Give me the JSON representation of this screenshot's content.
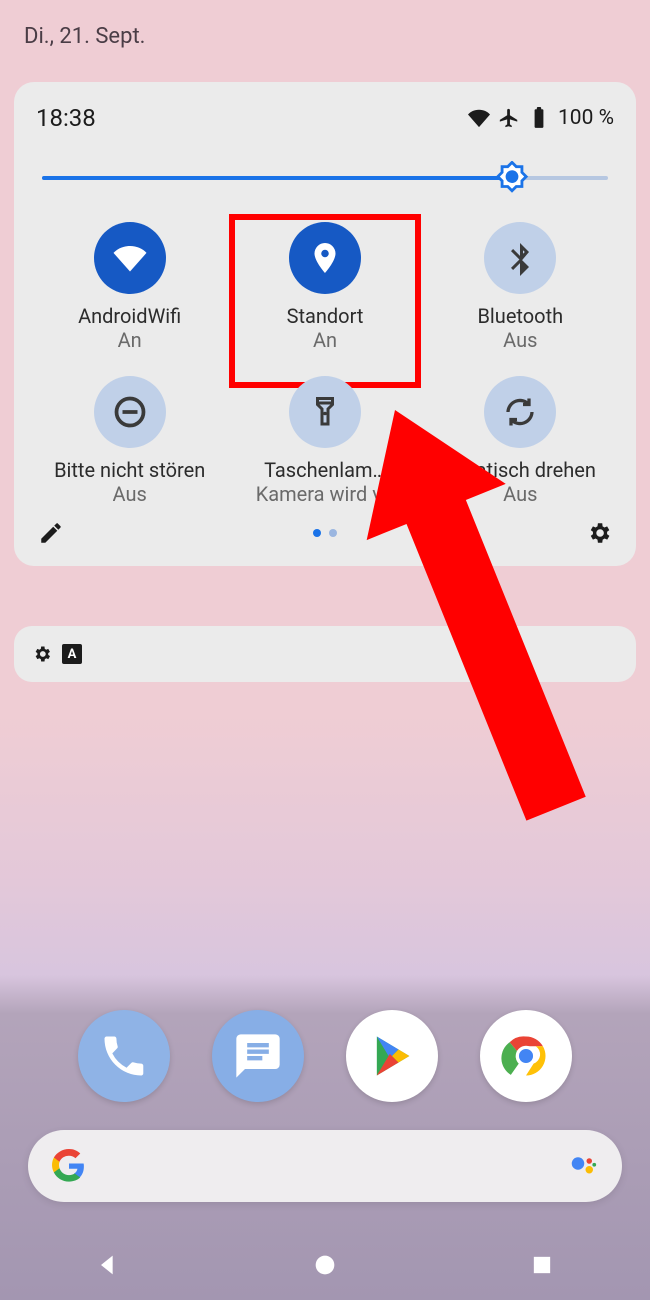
{
  "date": "Di., 21. Sept.",
  "status": {
    "time": "18:38",
    "battery": "100 %"
  },
  "brightness_percent": 83,
  "tiles": [
    {
      "label": "AndroidWifi",
      "state": "An"
    },
    {
      "label": "Standort",
      "state": "An"
    },
    {
      "label": "Bluetooth",
      "state": "Aus"
    },
    {
      "label": "Bitte nicht stören",
      "state": "Aus"
    },
    {
      "label": "Taschenlam…",
      "state": "Kamera wird v…"
    },
    {
      "label": "…matisch drehen",
      "state": "Aus"
    }
  ],
  "pager": {
    "current": 0,
    "total": 2
  }
}
